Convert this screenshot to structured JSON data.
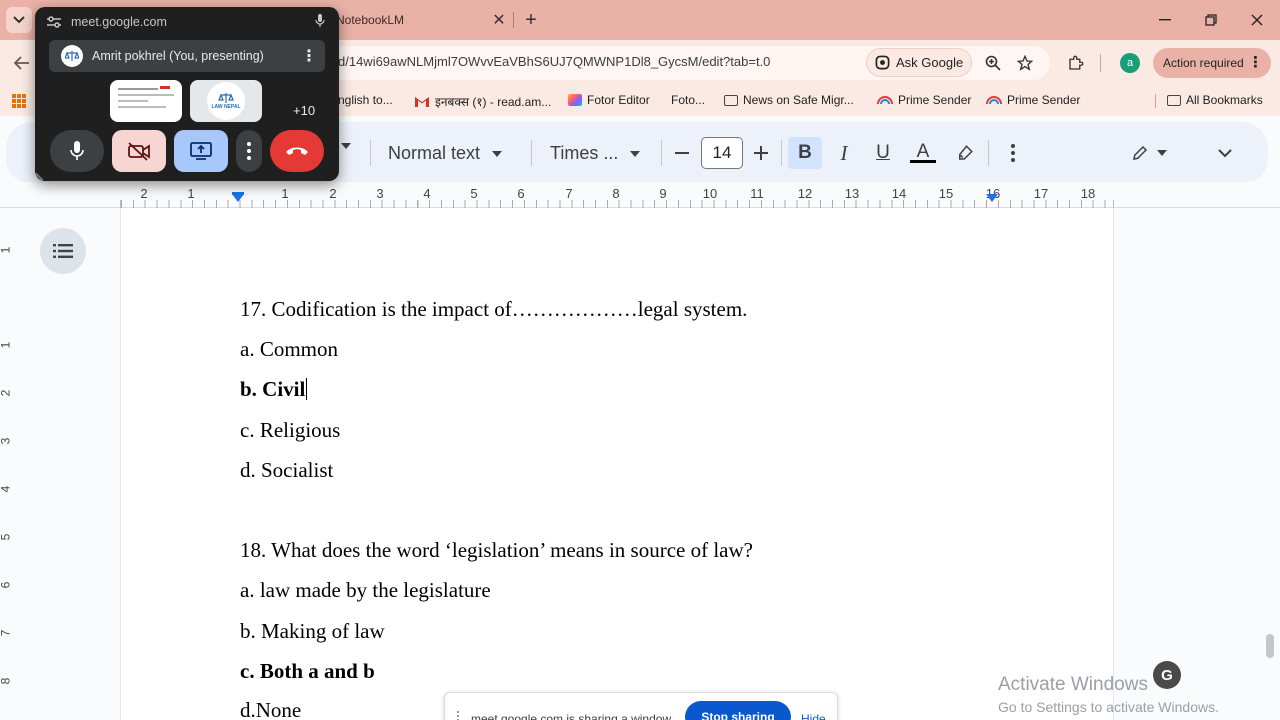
{
  "browser": {
    "tab_title": "NotebookLM",
    "url": "d/14wi69awNLMjml7OWvvEaVBhS6UJ7QMWNP1Dl8_GycsM/edit?tab=t.0",
    "ask_google_label": "Ask Google",
    "profile_initial": "a",
    "action_required_label": "Action required",
    "bookmarks": [
      {
        "label": "nglish to..."
      },
      {
        "label": "इनबक्स (१) - read.am..."
      },
      {
        "label": "Fotor Editor"
      },
      {
        "label": "Foto..."
      },
      {
        "label": "News on Safe Migr..."
      },
      {
        "label": "Prime Sender"
      },
      {
        "label": "Prime Sender"
      }
    ],
    "all_bookmarks_label": "All Bookmarks"
  },
  "docs_toolbar": {
    "paragraph_style": "Normal text",
    "font_family": "Times ...",
    "font_size": "14",
    "bold": "B",
    "italic": "I",
    "underline": "U",
    "text_color": "A"
  },
  "ruler": {
    "numbers": [
      "2",
      "1",
      "1",
      "2",
      "3",
      "4",
      "5",
      "6",
      "7",
      "8",
      "9",
      "10",
      "11",
      "12",
      "13",
      "14",
      "15",
      "16",
      "17",
      "18"
    ],
    "vertical_numbers": [
      "1",
      "1",
      "2",
      "3",
      "4",
      "5",
      "6",
      "7",
      "8"
    ]
  },
  "document": {
    "lines": [
      {
        "text": "17. Codification is the impact of………………legal system.",
        "bold": false
      },
      {
        "text": "a. Common",
        "bold": false
      },
      {
        "text": "b. Civil",
        "bold": true
      },
      {
        "text": "c. Religious",
        "bold": false
      },
      {
        "text": "d. Socialist",
        "bold": false
      },
      {
        "text": "18. What does the word ‘legislation’ means in source of law?",
        "bold": false
      },
      {
        "text": "a. law made by the legislature",
        "bold": false
      },
      {
        "text": "b. Making of law",
        "bold": false
      },
      {
        "text": "c. Both a and b",
        "bold": true
      },
      {
        "text": "d.None",
        "bold": false
      }
    ]
  },
  "meet": {
    "domain": "meet.google.com",
    "presenter": "Amrit pokhrel (You, presenting)",
    "thumb_label": "LAW NEPAL",
    "more_participants": "+10"
  },
  "share_bar": {
    "text": "meet.google.com is sharing a window",
    "stop_label": "Stop sharing",
    "hide_label": "Hide"
  },
  "watermark": {
    "title": "Activate Windows",
    "subtitle": "Go to Settings to activate Windows."
  },
  "colors": {
    "tab_strip": "#eab2a6",
    "toolbar": "#fbe9e4",
    "docs_accent": "#1a73e8",
    "end_call": "#e53935",
    "camera_off": "#f7d5d2",
    "present": "#a8c7fa"
  }
}
